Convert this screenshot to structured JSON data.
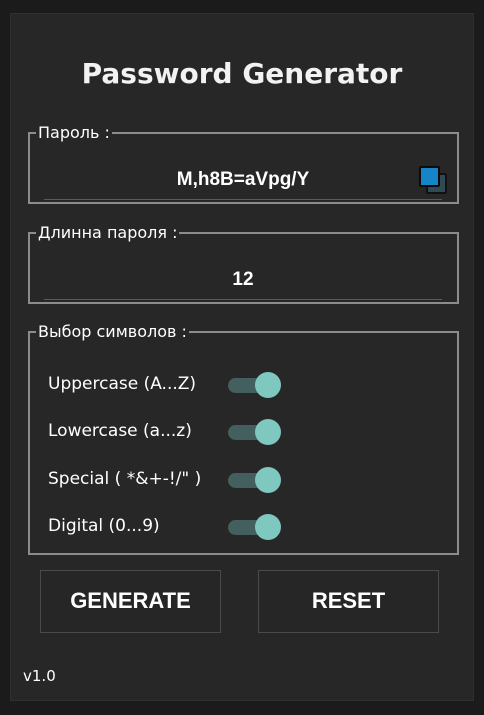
{
  "app": {
    "title": "Password Generator",
    "version": "v1.0"
  },
  "password": {
    "legend": "Пароль :",
    "value": "M,h8B=aVpg/Y",
    "copy_icon": "copy-icon"
  },
  "length": {
    "legend": "Длинна пароля :",
    "value": "12"
  },
  "symbols": {
    "legend": "Выбор символов :",
    "options": [
      {
        "label": "Uppercase (A...Z)",
        "enabled": true
      },
      {
        "label": "Lowercase (a...z)",
        "enabled": true
      },
      {
        "label": "Special ( *&+-!/\" )",
        "enabled": true
      },
      {
        "label": "Digital (0...9)",
        "enabled": true
      }
    ]
  },
  "actions": {
    "generate_label": "GENERATE",
    "reset_label": "RESET"
  },
  "colors": {
    "background": "#272727",
    "toggle_on_thumb": "#7ec8c0",
    "toggle_on_track": "#44605e",
    "copy_icon_accent": "#1585c8",
    "border": "#8c8c8c"
  }
}
